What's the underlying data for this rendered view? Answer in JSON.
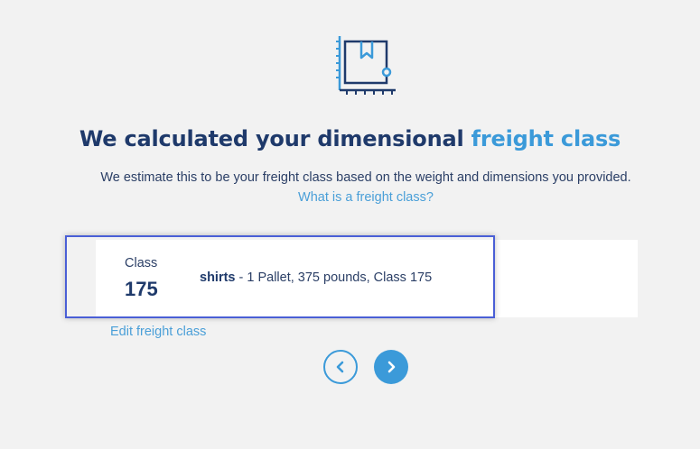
{
  "header": {
    "icon": "box-measure-icon",
    "title_main": "We calculated your dimensional ",
    "title_accent": "freight class",
    "subtitle": "We estimate this to be your freight class based on the weight and dimensions you provided.",
    "help_link": "What is a freight class?"
  },
  "result": {
    "class_label": "Class",
    "class_value": "175",
    "item_name": "shirts",
    "item_details": " - 1 Pallet, 375 pounds, Class 175"
  },
  "actions": {
    "edit_link": "Edit freight class",
    "prev_icon": "chevron-left-icon",
    "next_icon": "chevron-right-icon"
  },
  "colors": {
    "primary_dark": "#1f3a6b",
    "accent_blue": "#3b9ad9",
    "highlight_border": "#4a5fd6",
    "background": "#f2f2f2"
  }
}
